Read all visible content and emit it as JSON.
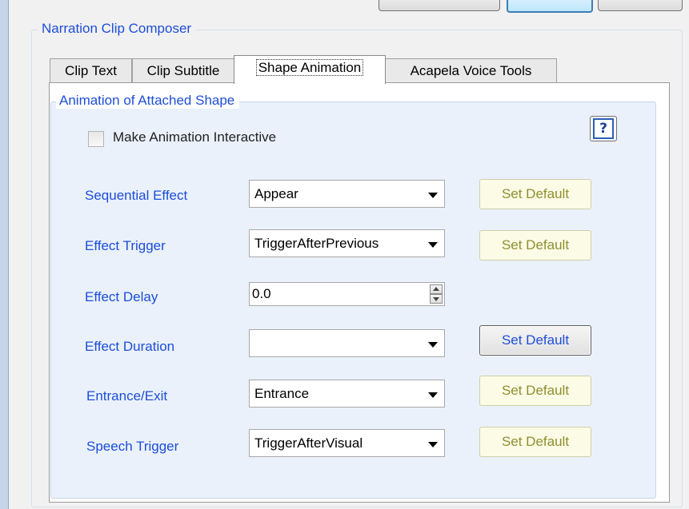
{
  "window": {
    "group_title": "Narration Clip Composer"
  },
  "tabs": [
    {
      "label": "Clip Text"
    },
    {
      "label": "Clip Subtitle"
    },
    {
      "label": "Shape Animation"
    },
    {
      "label": "Acapela Voice Tools"
    }
  ],
  "active_tab": "Shape Animation",
  "panel": {
    "group_title": "Animation of Attached Shape",
    "help_icon": "question-mark-icon",
    "help_label": "?",
    "interactive_checkbox": {
      "label": "Make Animation Interactive",
      "checked": false
    },
    "fields": {
      "sequential_effect": {
        "label": "Sequential Effect",
        "value": "Appear",
        "button": "Set Default"
      },
      "effect_trigger": {
        "label": "Effect Trigger",
        "value": "TriggerAfterPrevious",
        "button": "Set Default"
      },
      "effect_delay": {
        "label": "Effect Delay",
        "value": "0.0"
      },
      "effect_duration": {
        "label": "Effect Duration",
        "value": "",
        "button": "Set Default"
      },
      "entrance_exit": {
        "label": "Entrance/Exit",
        "value": "Entrance",
        "button": "Set Default"
      },
      "speech_trigger": {
        "label": "Speech Trigger",
        "value": "TriggerAfterVisual",
        "button": "Set Default"
      }
    }
  }
}
